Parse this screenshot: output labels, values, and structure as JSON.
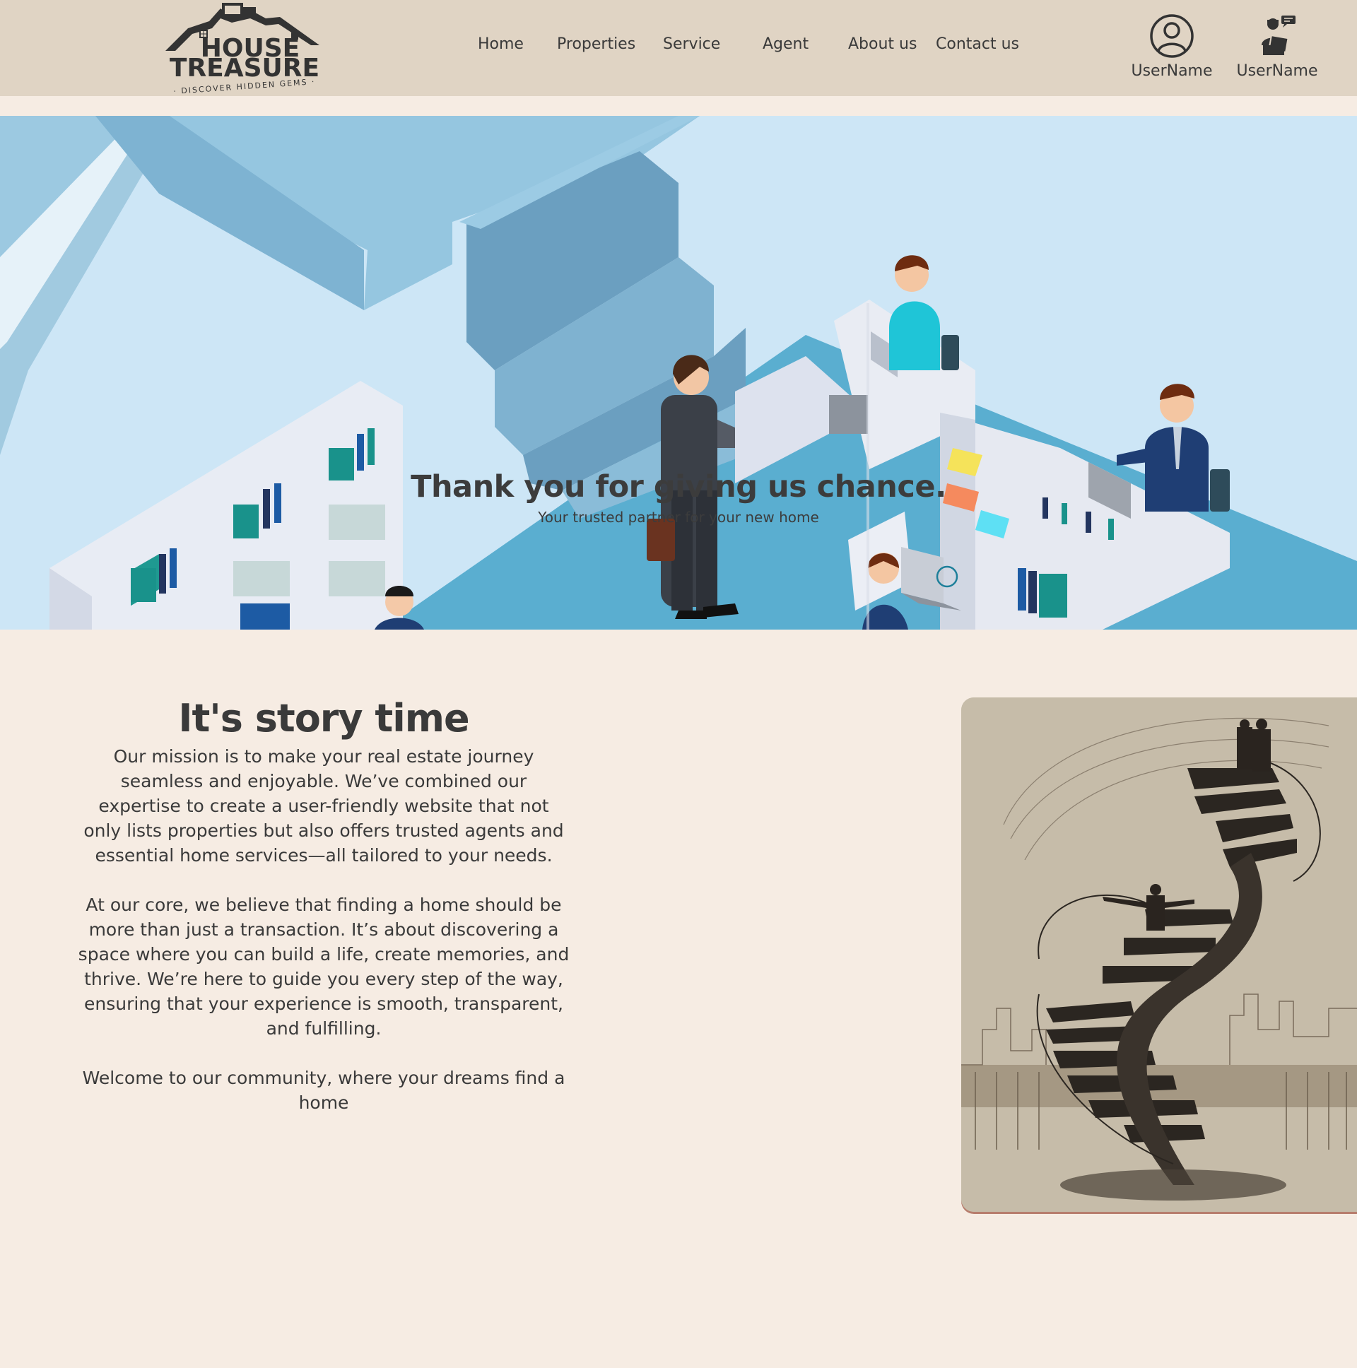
{
  "header": {
    "logo": {
      "line1": "HOUSE",
      "line2": "TREASURE",
      "tagline": "· DISCOVER HIDDEN GEMS ·"
    },
    "nav": [
      {
        "label": "Home"
      },
      {
        "label": "Properties"
      },
      {
        "label": "Service"
      },
      {
        "label": "Agent"
      },
      {
        "label": "About us"
      },
      {
        "label": "Contact us"
      }
    ],
    "users": [
      {
        "label": "UserName",
        "icon": "user-circle-icon"
      },
      {
        "label": "UserName",
        "icon": "agent-chat-icon"
      }
    ]
  },
  "hero": {
    "title": "Thank you for giving us chance.",
    "subtitle": "Your trusted partner for your new home"
  },
  "story": {
    "heading": "It's story time",
    "paragraphs": [
      "Our mission is to make your real estate journey seamless and enjoyable. We’ve combined our expertise to create a user-friendly website that not only lists properties but also offers trusted agents and essential home services—all tailored to your needs.",
      "At our core, we believe that finding a home should be more than just a transaction. It’s about discovering a space where you can build a life, create memories, and thrive. We’re here to guide you every step of the way, ensuring that your experience is smooth, transparent, and fulfilling.",
      "Welcome to our community, where your dreams find a home"
    ]
  },
  "colors": {
    "header_bg": "#e0d4c4",
    "page_bg": "#f6ece3",
    "hero_sky": "#cde6f6",
    "hero_floor": "#5aaed0",
    "text": "#3a3a3a"
  }
}
